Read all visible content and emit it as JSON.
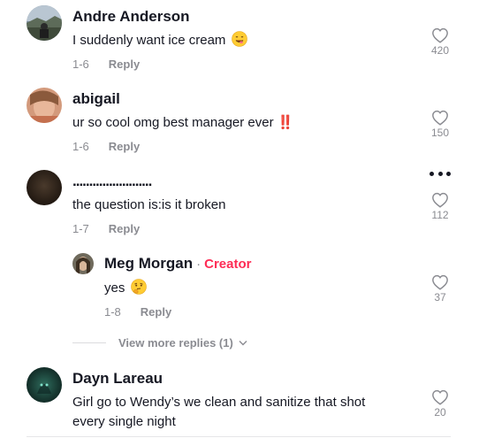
{
  "comments": [
    {
      "author": "Andre Anderson",
      "text": "I suddenly want ice cream",
      "emoji": "yum-face-emoji",
      "date": "1-6",
      "reply_label": "Reply",
      "likes": "420"
    },
    {
      "author": "abigail",
      "text": "ur so cool omg best manager ever ‼️",
      "date": "1-6",
      "reply_label": "Reply",
      "likes": "150"
    },
    {
      "author": "........................",
      "text": "the question is:is it broken",
      "date": "1-7",
      "reply_label": "Reply",
      "likes": "112"
    },
    {
      "author": "Dayn Lareau",
      "text_line1": "Girl go to Wendy’s we clean and sanitize that shot",
      "text_line2": "every single night",
      "likes": "20"
    }
  ],
  "reply": {
    "author": "Meg Morgan",
    "separator": "·",
    "creator_label": "Creator",
    "text": "yes",
    "emoji": "thinking-face-emoji",
    "date": "1-8",
    "reply_label": "Reply",
    "likes": "37"
  },
  "view_more": {
    "label": "View more replies (1)"
  },
  "colors": {
    "text": "#161823",
    "muted": "#8a8b91",
    "creator": "#fe2c55"
  }
}
